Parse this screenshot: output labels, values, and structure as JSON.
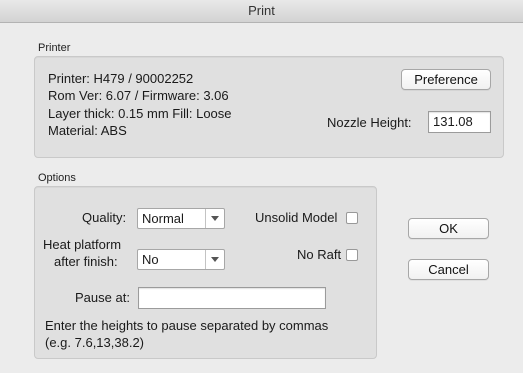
{
  "window": {
    "title": "Print"
  },
  "printer_section": {
    "label": "Printer",
    "printer_line": "Printer: H479 / 90002252",
    "version_line": "Rom Ver: 6.07 / Firmware: 3.06",
    "layer_line": "Layer thick: 0.15 mm  Fill: Loose",
    "material_line": "Material: ABS",
    "preference_button": "Preference",
    "nozzle_label": "Nozzle Height:",
    "nozzle_value": "131.08"
  },
  "options_section": {
    "label": "Options",
    "quality_label": "Quality:",
    "quality_value": "Normal",
    "heat_label_line1": "Heat platform",
    "heat_label_line2": "after finish:",
    "heat_value": "No",
    "unsolid_label": "Unsolid Model",
    "unsolid_checked": false,
    "noraft_label": "No Raft",
    "noraft_checked": false,
    "pause_label": "Pause at:",
    "pause_value": "",
    "hint_line1": "Enter the heights to pause separated by commas",
    "hint_line2": "(e.g. 7.6,13,38.2)"
  },
  "buttons": {
    "ok": "OK",
    "cancel": "Cancel"
  }
}
